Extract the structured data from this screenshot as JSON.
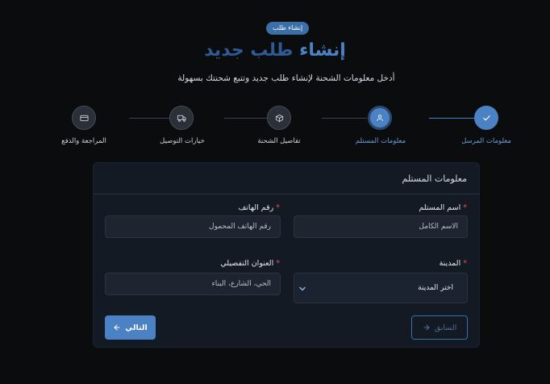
{
  "badge": "إنشاء طلب",
  "title": {
    "part1": "إنشاء",
    "part2": "طلب جديد"
  },
  "subtitle": "أدخل معلومات الشحنة لإنشاء طلب جديد وتتبع شحنتك بسهولة",
  "steps": [
    {
      "label": "معلومات المرسل",
      "icon": "check-icon",
      "state": "done"
    },
    {
      "label": "معلومات المستلم",
      "icon": "user-icon",
      "state": "active"
    },
    {
      "label": "تفاصيل الشحنة",
      "icon": "package-icon",
      "state": "pending"
    },
    {
      "label": "خيارات التوصيل",
      "icon": "truck-icon",
      "state": "pending"
    },
    {
      "label": "المراجعة والدفع",
      "icon": "credit-card-icon",
      "state": "pending"
    }
  ],
  "form": {
    "title": "معلومات المستلم",
    "recipient_name": {
      "label": "اسم المستلم",
      "required": "*",
      "placeholder": "الاسم الكامل"
    },
    "phone": {
      "label": "رقم الهاتف",
      "required": "*",
      "placeholder": "رقم الهاتف المحمول"
    },
    "city": {
      "label": "المدينة",
      "required": "*",
      "selected": "اختر المدينة"
    },
    "address": {
      "label": "العنوان التفصيلي",
      "required": "*",
      "placeholder": "الحي، الشارع، البناء"
    },
    "prev_label": "السابق",
    "next_label": "التالي"
  },
  "colors": {
    "accent": "#4a82c4",
    "background": "#0b0c0e",
    "card": "#141a24",
    "required": "#e05252"
  }
}
